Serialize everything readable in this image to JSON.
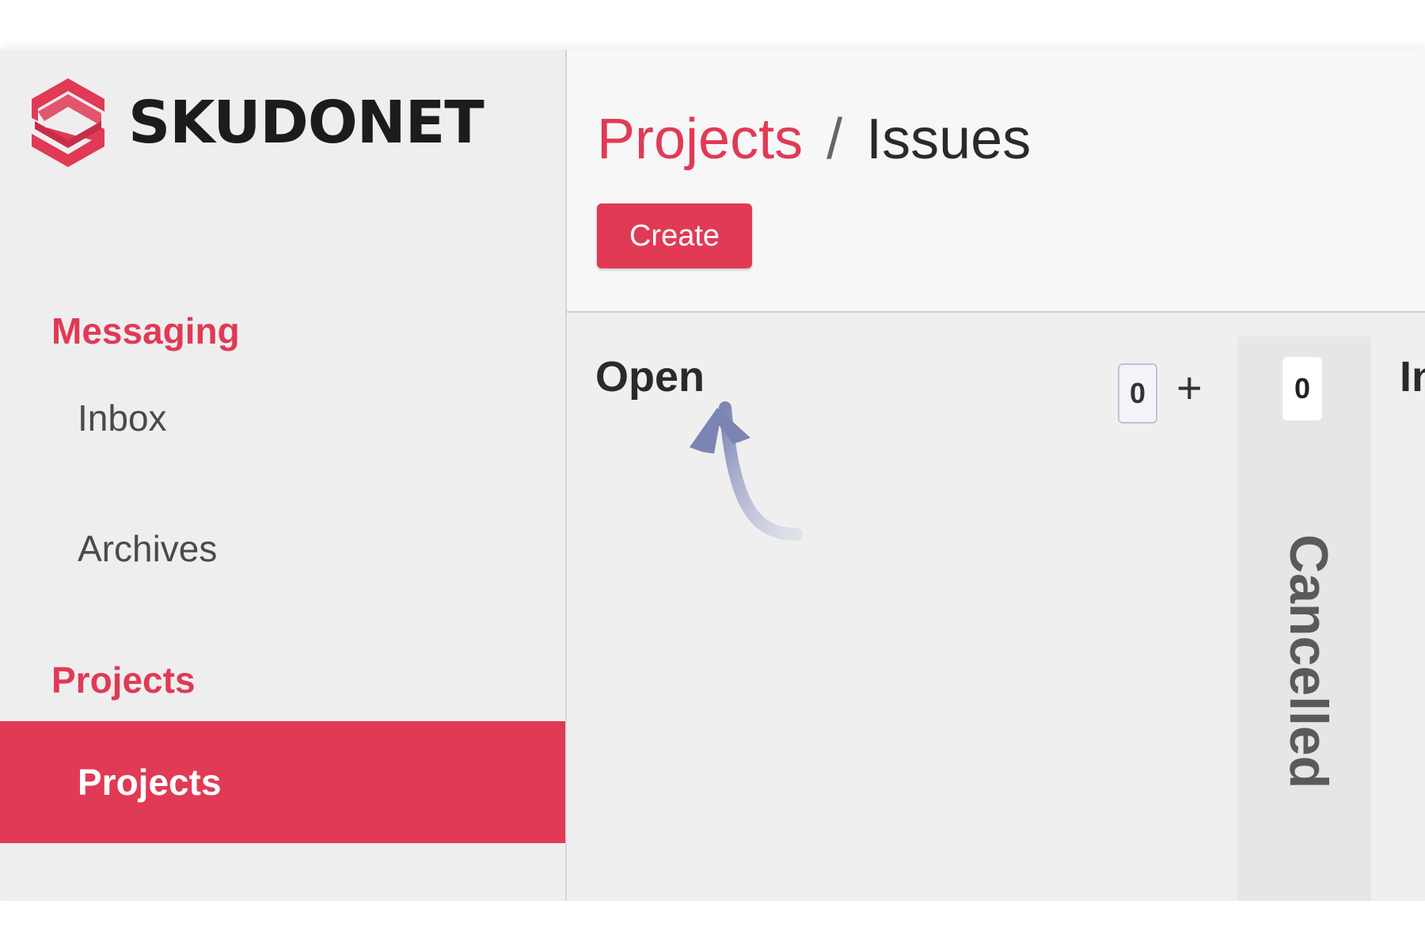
{
  "brand": {
    "name": "SKUDONET",
    "accent_color": "#e03a55"
  },
  "sidebar": {
    "sections": [
      {
        "title": "Messaging",
        "items": [
          {
            "label": "Inbox"
          },
          {
            "label": "Archives"
          }
        ]
      },
      {
        "title": "Projects",
        "items": [
          {
            "label": "Projects",
            "active": true
          }
        ]
      }
    ]
  },
  "header": {
    "breadcrumb_parent": "Projects",
    "breadcrumb_separator": "/",
    "breadcrumb_current": "Issues",
    "create_label": "Create"
  },
  "board": {
    "columns": [
      {
        "title": "Open",
        "count": "0",
        "add_symbol": "+"
      },
      {
        "title": "Cancelled",
        "count": "0",
        "folded": true
      },
      {
        "title": "In"
      }
    ]
  },
  "icons": {
    "logo": "skudonet-logo-icon",
    "add": "plus-icon",
    "hint_arrow": "curved-arrow-icon"
  }
}
